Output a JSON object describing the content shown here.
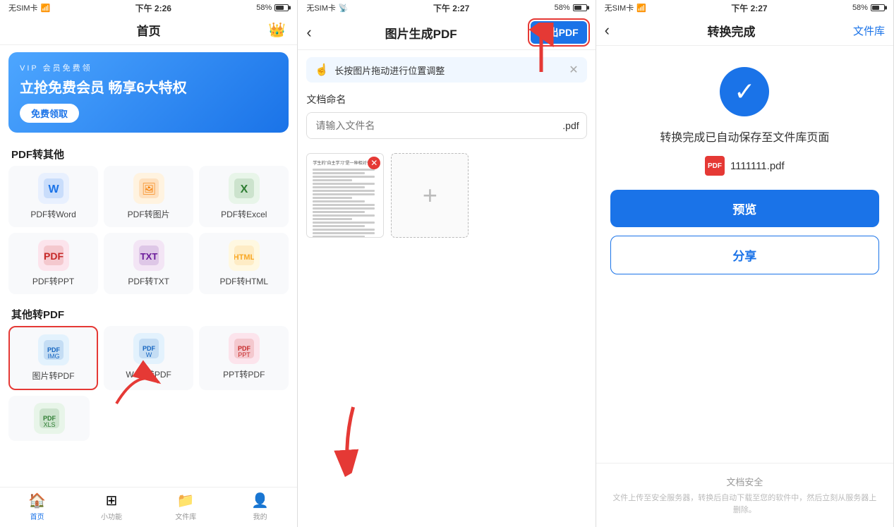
{
  "screen1": {
    "status": {
      "signal": "无SIM卡",
      "wifi": "📶",
      "time": "下午 2:26",
      "battery": "58%"
    },
    "title": "首页",
    "vip": {
      "sub": "VIP 会员免费领",
      "title": "立抢免费会员 畅享6大特权",
      "btn": "免费领取"
    },
    "section1_title": "PDF转其他",
    "features1": [
      {
        "label": "PDF转Word",
        "icon": "W"
      },
      {
        "label": "PDF转图片",
        "icon": "🖼"
      },
      {
        "label": "PDF转Excel",
        "icon": "X"
      },
      {
        "label": "PDF转PPT",
        "icon": "P"
      },
      {
        "label": "PDF转TXT",
        "icon": "T"
      },
      {
        "label": "PDF转HTML",
        "icon": "H"
      }
    ],
    "section2_title": "其他转PDF",
    "features2": [
      {
        "label": "图片转PDF",
        "icon": "📄",
        "highlighted": true
      },
      {
        "label": "Word转PDF",
        "icon": "W"
      },
      {
        "label": "PPT转PDF",
        "icon": "P"
      }
    ],
    "bottom_nav": [
      {
        "label": "首页",
        "icon": "🏠",
        "active": true
      },
      {
        "label": "小功能",
        "icon": "⊞",
        "active": false
      },
      {
        "label": "文件库",
        "icon": "📁",
        "active": false
      },
      {
        "label": "我的",
        "icon": "👤",
        "active": false
      }
    ]
  },
  "screen2": {
    "status": {
      "signal": "无SIM卡",
      "wifi": "📡",
      "time": "下午 2:27",
      "battery": "58%"
    },
    "nav": {
      "back": "‹",
      "title": "图片生成PDF",
      "action": "导出PDF"
    },
    "tip": "长按图片拖动进行位置调整",
    "doc_name_label": "文档命名",
    "doc_name_placeholder": "请输入文件名",
    "doc_name_suffix": ".pdf",
    "add_image_icon": "+"
  },
  "screen3": {
    "status": {
      "signal": "无SIM卡",
      "wifi": "📶",
      "time": "下午 2:27",
      "battery": "58%"
    },
    "nav": {
      "back": "‹",
      "title": "转换完成",
      "right": "文件库"
    },
    "check": "✓",
    "complete_text": "转换完成已自动保存至文件库页面",
    "file_name": "1111111.pdf",
    "btn_preview": "预览",
    "btn_share": "分享",
    "security_title": "文档安全",
    "security_desc": "文件上传至安全服务器，转换后自动下载至您的软件中，然后立刻从服务器上删除。"
  }
}
